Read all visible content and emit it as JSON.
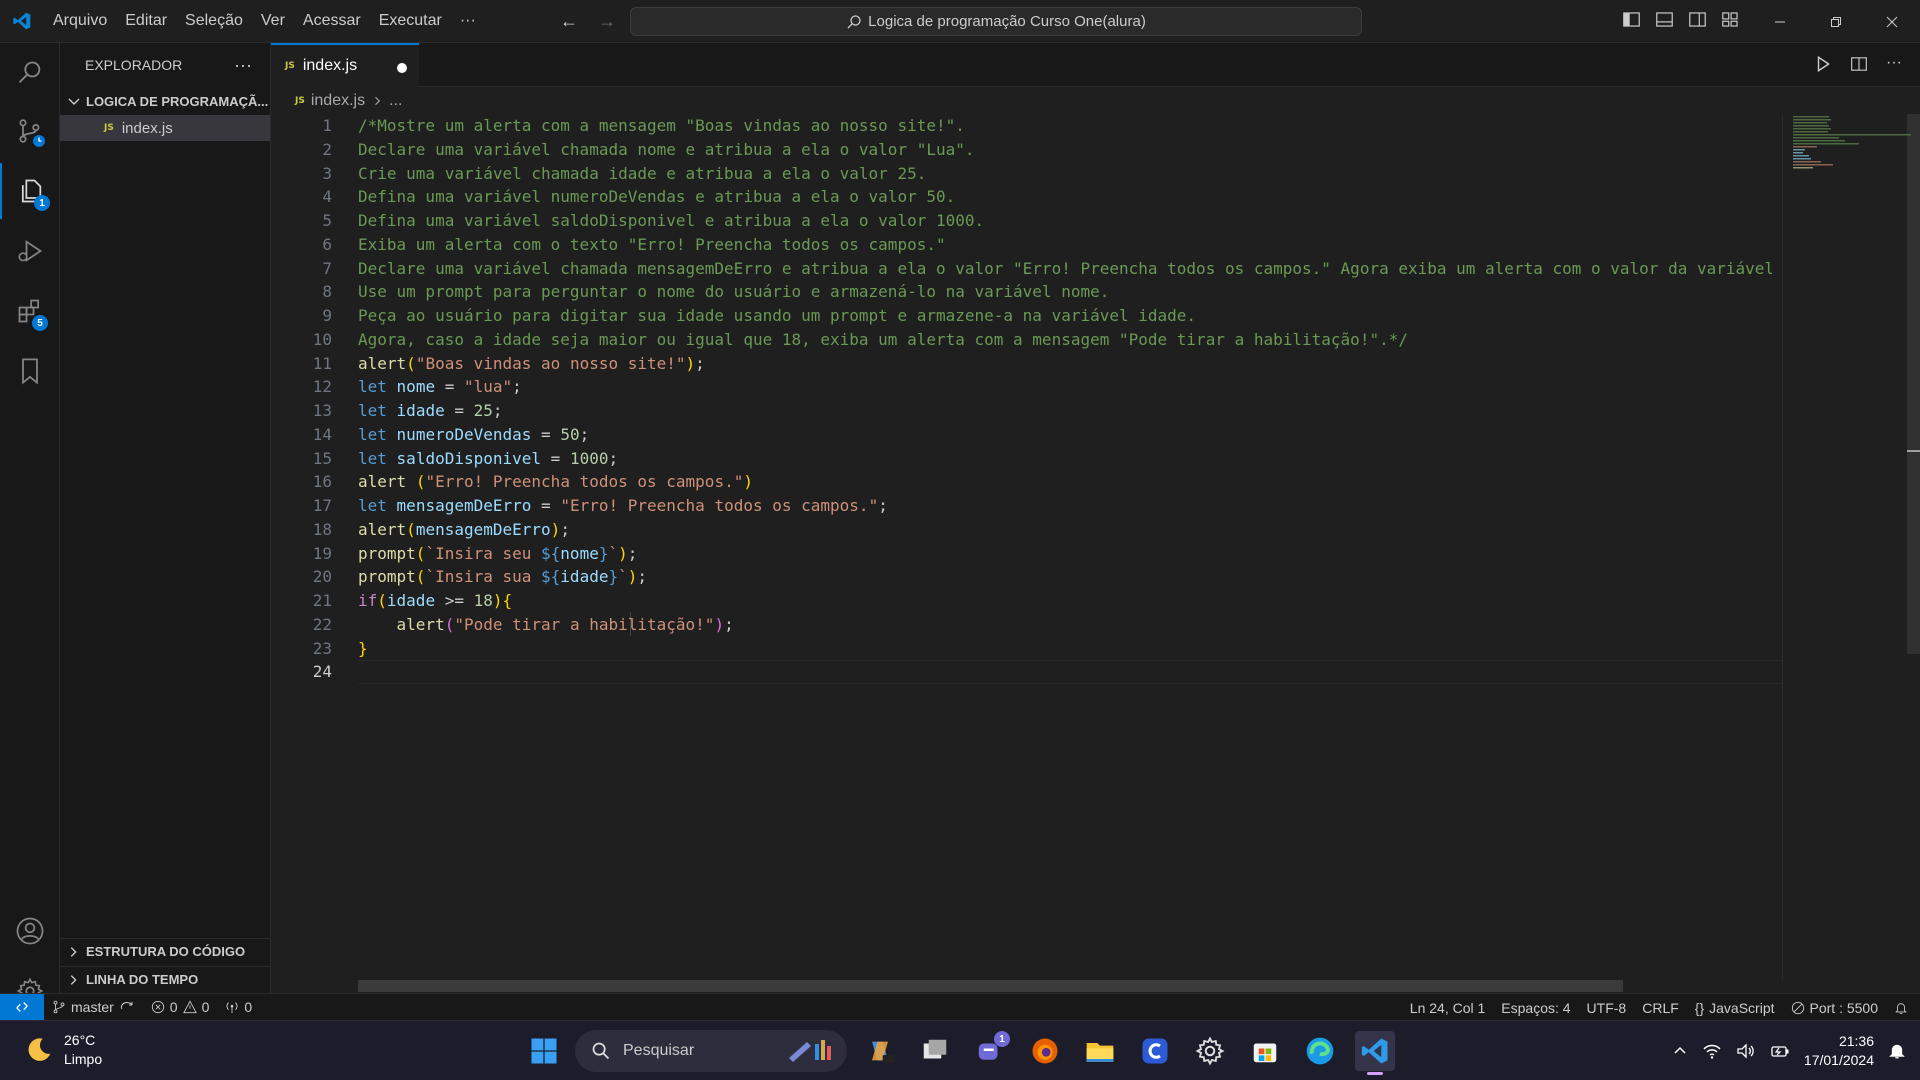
{
  "menu": [
    "Arquivo",
    "Editar",
    "Seleção",
    "Ver",
    "Acessar",
    "Executar",
    "···"
  ],
  "search": {
    "text": "Logica de programação Curso One(alura)"
  },
  "sidebar": {
    "header": "EXPLORADOR",
    "more": "···",
    "folder": "LOGICA DE PROGRAMAÇÃ...",
    "file": "index.js",
    "sections": [
      "ESTRUTURA DO CÓDIGO",
      "LINHA DO TEMPO"
    ]
  },
  "activity_badges": {
    "explorer": "1",
    "extensions": "5"
  },
  "tab": {
    "label": "index.js",
    "icon": "JS"
  },
  "breadcrumb": {
    "file": "index.js",
    "more": "..."
  },
  "editor": {
    "current_line": 24,
    "lines": [
      "1",
      "2",
      "3",
      "4",
      "5",
      "6",
      "7",
      "8",
      "9",
      "10",
      "11",
      "12",
      "13",
      "14",
      "15",
      "16",
      "17",
      "18",
      "19",
      "20",
      "21",
      "22",
      "23",
      "24"
    ],
    "comment_lines": [
      "/*Mostre um alerta com a mensagem \"Boas vindas ao nosso site!\".",
      "Declare uma variável chamada nome e atribua a ela o valor \"Lua\".",
      "Crie uma variável chamada idade e atribua a ela o valor 25.",
      "Defina uma variável numeroDeVendas e atribua a ela o valor 50.",
      "Defina uma variável saldoDisponivel e atribua a ela o valor 1000.",
      "Exiba um alerta com o texto \"Erro! Preencha todos os campos.\"",
      "Declare uma variável chamada mensagemDeErro e atribua a ela o valor \"Erro! Preencha todos os campos.\" Agora exiba um alerta com o valor da variável",
      "Use um prompt para perguntar o nome do usuário e armazená-lo na variável nome.",
      "Peça ao usuário para digitar sua idade usando um prompt e armazene-a na variável idade.",
      "Agora, caso a idade seja maior ou igual que 18, exiba um alerta com a mensagem \"Pode tirar a habilitação!\".*/"
    ],
    "code": {
      "l11_fn": "alert",
      "l11_str": "\"Boas vindas ao nosso site!\"",
      "l12_var": "nome",
      "l12_str": "\"lua\"",
      "l13_var": "idade",
      "l13_num": "25",
      "l14_var": "numeroDeVendas",
      "l14_num": "50",
      "l15_var": "saldoDisponivel",
      "l15_num": "1000",
      "l16_fn": "alert",
      "l16_str": "\"Erro! Preencha todos os campos.\"",
      "l17_var": "mensagemDeErro",
      "l17_str": "\"Erro! Preencha todos os campos.\"",
      "l18_fn": "alert",
      "l18_var": "mensagemDeErro",
      "l19_fn": "prompt",
      "l19_str": "`Insira seu ",
      "l19_var": "nome",
      "l20_fn": "prompt",
      "l20_str": "`Insira sua ",
      "l20_var": "idade",
      "l21_kw": "if",
      "l21_var": "idade",
      "l21_num": "18",
      "l22_fn": "alert",
      "l22_str": "\"Pode tirar a habilitação!\"",
      "let": "let"
    }
  },
  "status": {
    "branch": "master",
    "errors": "0",
    "warnings": "0",
    "ports": "0",
    "position": "Ln 24, Col 1",
    "spaces": "Espaços: 4",
    "encoding": "UTF-8",
    "eol": "CRLF",
    "language": "JavaScript",
    "port": "Port : 5500"
  },
  "taskbar": {
    "temp": "26°C",
    "weather": "Limpo",
    "search": "Pesquisar",
    "time": "21:36",
    "date": "17/01/2024",
    "teams_badge": "1"
  },
  "colors": {
    "accent": "#0078d4",
    "comment": "#6a9955",
    "keyword": "#569cd6",
    "string": "#ce9178"
  }
}
